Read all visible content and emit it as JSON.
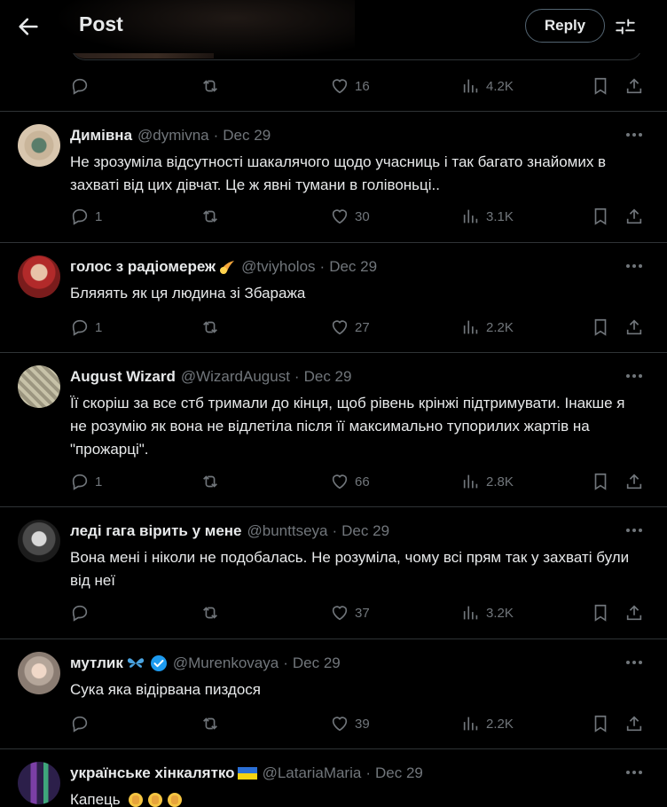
{
  "header": {
    "title": "Post",
    "reply_label": "Reply"
  },
  "main_post": {
    "likes": "16",
    "views": "4.2K"
  },
  "tweets": [
    {
      "name": "Димівна",
      "handle": "@dymivna",
      "date": "Dec 29",
      "text": "Не зрозуміла відсутності шакалячого щодо учасниць і так багато знайомих в захваті від цих дівчат. Це ж явні тумани в голівоньці..",
      "replies": "1",
      "likes": "30",
      "views": "3.1K"
    },
    {
      "name": "голос з радіомереж",
      "handle": "@tviyholos",
      "date": "Dec 29",
      "text": "Бляяять як ця людина зі Збаража",
      "replies": "1",
      "likes": "27",
      "views": "2.2K"
    },
    {
      "name": "August Wizard",
      "handle": "@WizardAugust",
      "date": "Dec 29",
      "text": "Її скоріш за все стб тримали до кінця, щоб рівень крінжі підтримувати. Інакше я не розумію як вона не відлетіла після її максимально тупорилих жартів на \"прожарці\".",
      "replies": "1",
      "likes": "66",
      "views": "2.8K"
    },
    {
      "name": "леді гага вірить у мене",
      "handle": "@bunttseya",
      "date": "Dec 29",
      "text": "Вона мені і ніколи не подобалась. Не розуміла, чому всі прям так у захваті були від неї",
      "replies": "",
      "likes": "37",
      "views": "3.2K"
    },
    {
      "name": "мутлик",
      "handle": "@Murenkovaya",
      "date": "Dec 29",
      "text": "Сука  яка відірвана пиздося",
      "replies": "",
      "likes": "39",
      "views": "2.2K"
    },
    {
      "name": "українське хінкалятко",
      "handle": "@LatariaMaria",
      "date": "Dec 29",
      "text": "Капець",
      "replies": "",
      "likes": "",
      "views": ""
    }
  ],
  "colors": {
    "background": "#000000",
    "text": "#e7e9ea",
    "secondary": "#71767b",
    "border": "#2f3336",
    "verified": "#1d9bf0"
  }
}
